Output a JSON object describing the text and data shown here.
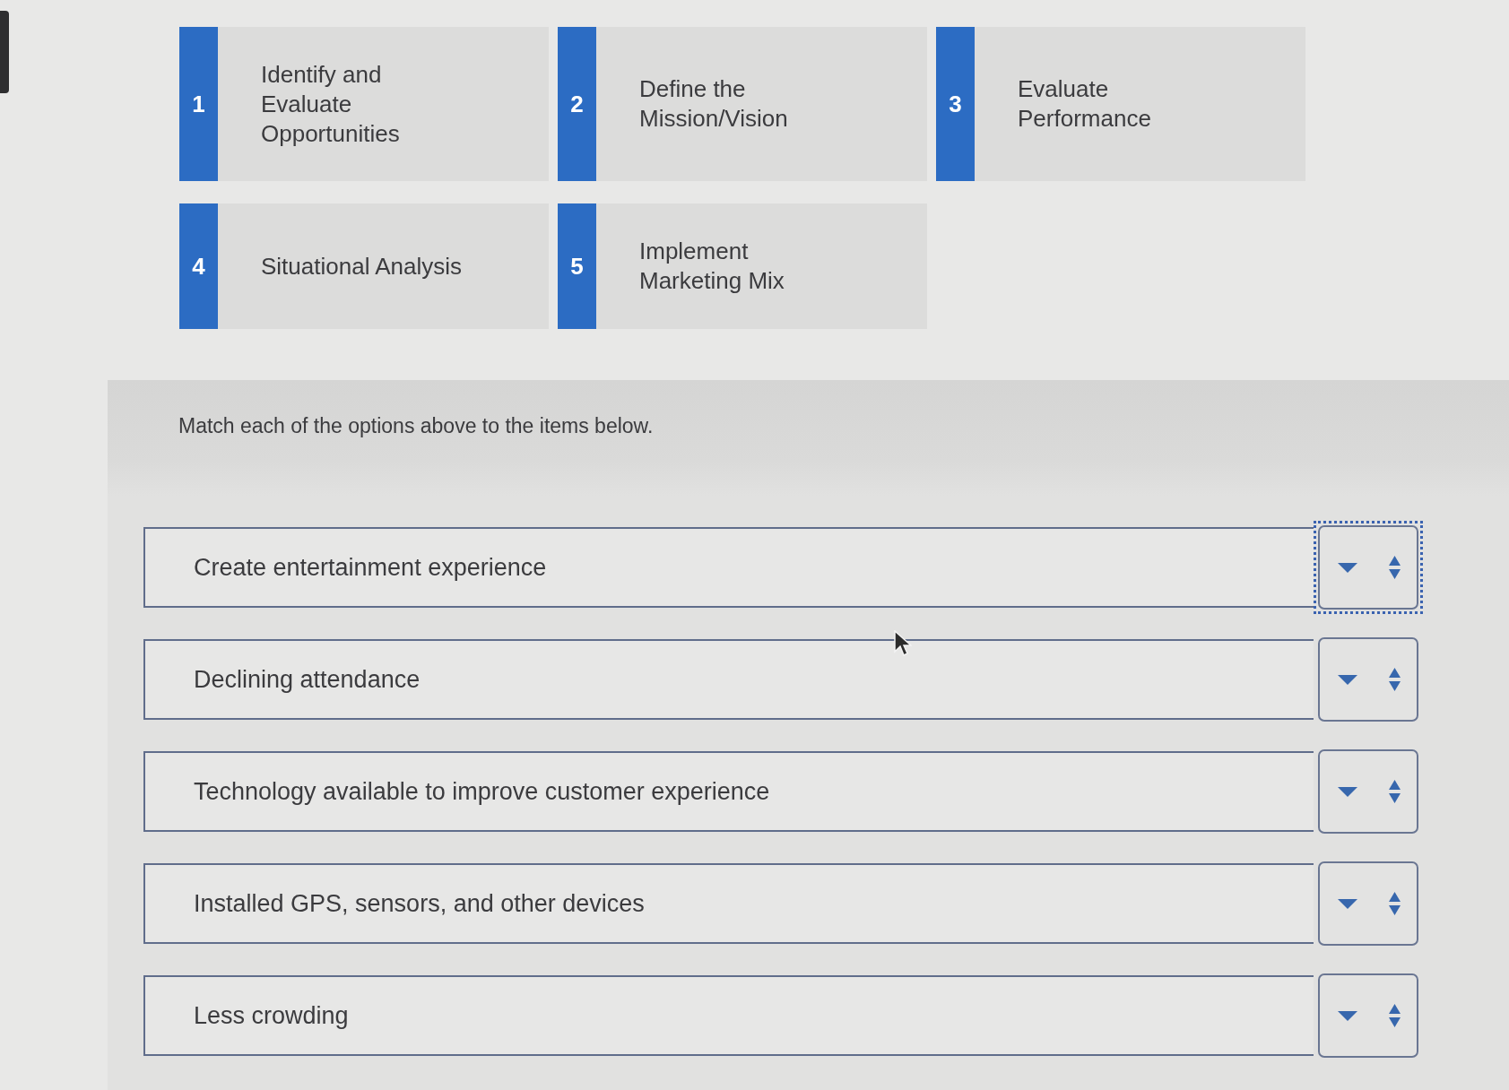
{
  "options": [
    {
      "number": "1",
      "label": "Identify and Evaluate Opportunities"
    },
    {
      "number": "2",
      "label": "Define the Mission/Vision"
    },
    {
      "number": "3",
      "label": "Evaluate Performance"
    },
    {
      "number": "4",
      "label": "Situational Analysis"
    },
    {
      "number": "5",
      "label": "Implement Marketing Mix"
    }
  ],
  "prompt": "Match each of the options above to the items below.",
  "items": [
    {
      "label": "Create entertainment experience",
      "focused": true
    },
    {
      "label": "Declining attendance",
      "focused": false
    },
    {
      "label": "Technology available to improve customer experience",
      "focused": false
    },
    {
      "label": "Installed GPS, sensors, and other devices",
      "focused": false
    },
    {
      "label": "Less crowding",
      "focused": false
    }
  ]
}
